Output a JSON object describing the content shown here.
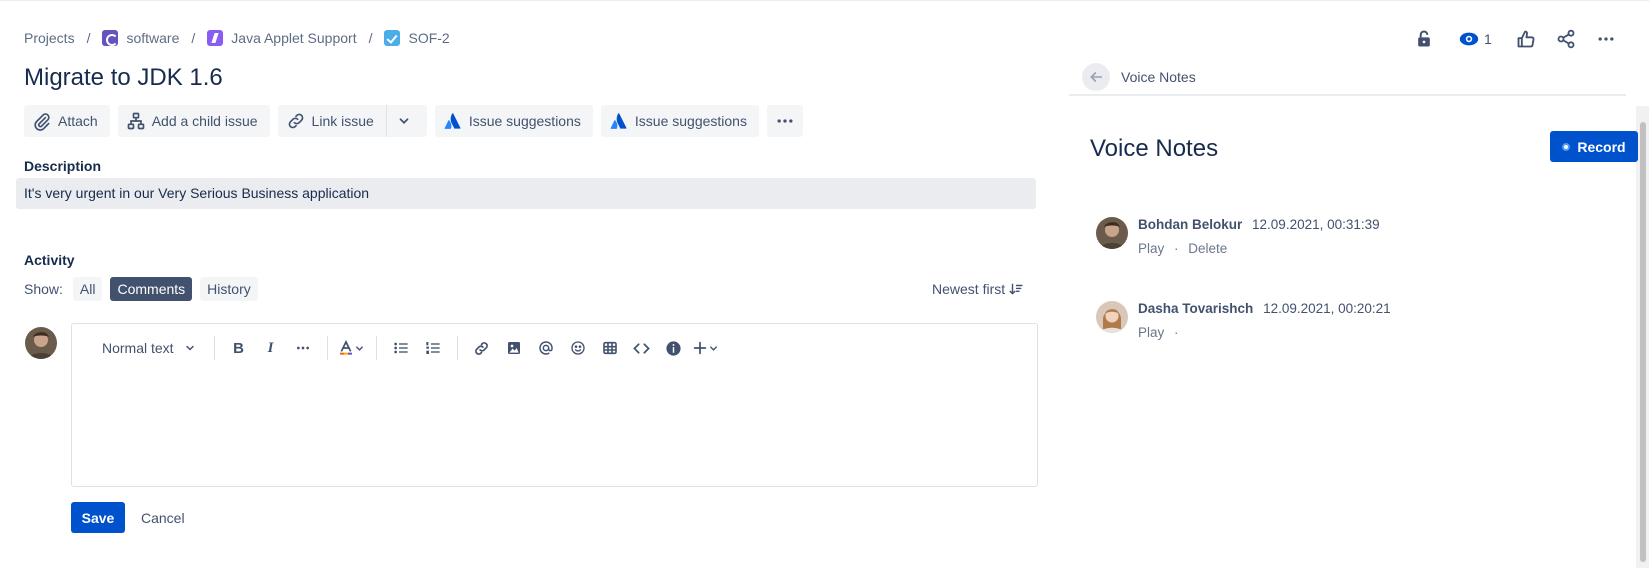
{
  "breadcrumb": {
    "projects": "Projects",
    "project": "software",
    "epic": "Java Applet Support",
    "issue_key": "SOF-2",
    "separator": "/"
  },
  "issue": {
    "title": "Migrate to JDK 1.6"
  },
  "actions": {
    "attach": "Attach",
    "add_child": "Add a child issue",
    "link_issue": "Link issue",
    "suggestions_1": "Issue suggestions",
    "suggestions_2": "Issue suggestions"
  },
  "description": {
    "label": "Description",
    "text": "It's very urgent in our Very Serious Business application"
  },
  "activity": {
    "label": "Activity",
    "show_label": "Show:",
    "filters": [
      "All",
      "Comments",
      "History"
    ],
    "active_filter": "Comments",
    "sort": "Newest first"
  },
  "editor": {
    "text_style": "Normal text",
    "save": "Save",
    "cancel": "Cancel"
  },
  "topbar": {
    "watch_count": "1"
  },
  "panel": {
    "header": "Voice Notes",
    "title": "Voice Notes",
    "record": "Record",
    "notes": [
      {
        "author": "Bohdan Belokur",
        "time": "12.09.2021, 00:31:39",
        "play": "Play",
        "dot": "·",
        "delete": "Delete"
      },
      {
        "author": "Dasha Tovarishch",
        "time": "12.09.2021, 00:20:21",
        "play": "Play",
        "dot": "·",
        "delete": ""
      }
    ]
  },
  "colors": {
    "primary": "#0052cc",
    "text": "#172b4d",
    "subtle": "#42526e",
    "chip_bg": "#f4f5f7",
    "chip_active": "#42526e"
  }
}
